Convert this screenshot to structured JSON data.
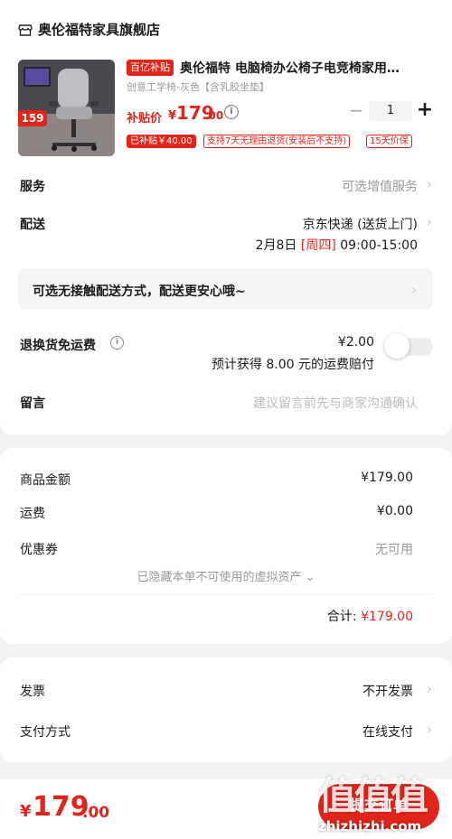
{
  "store": {
    "name": "奥伦福特家具旗舰店"
  },
  "product": {
    "promo_tag": "百亿补贴",
    "title": "奥伦福特 电脑椅办公椅子电竞椅家用…",
    "spec": "创意工学椅-灰色【含乳胶坐垫】",
    "subsidy_label": "补贴价",
    "price_symbol": "¥",
    "price_int": "179",
    "price_dec": ".00",
    "info_icon": "i",
    "quantity": "1",
    "qty_minus": "−",
    "qty_plus": "+",
    "image_badge": "159",
    "tags": [
      "已补贴￥40.00",
      "支持7天无理由退货(安装后不支持)",
      "15天价保"
    ]
  },
  "service": {
    "label": "服务",
    "value": "可选增值服务"
  },
  "delivery": {
    "label": "配送",
    "method": "京东快递 (送货上门)",
    "date": "2月8日",
    "weekday": "[周四]",
    "time": "09:00-15:00"
  },
  "contactless": {
    "text": "可选无接触配送方式，配送更安心哦~"
  },
  "return_shipping": {
    "label": "退换货免运费",
    "price": "¥2.00",
    "note": "预计获得 8.00 元的运费赔付",
    "enabled": false
  },
  "message": {
    "label": "留言",
    "placeholder": "建议留言前先与商家沟通确认"
  },
  "summary": {
    "goods_label": "商品金额",
    "goods_value": "¥179.00",
    "shipping_label": "运费",
    "shipping_value": "¥0.00",
    "coupon_label": "优惠券",
    "coupon_value": "无可用",
    "hidden_assets": "已隐藏本单不可使用的虚拟资产",
    "total_label": "合计:",
    "total_value": "¥179.00"
  },
  "invoice": {
    "label": "发票",
    "value": "不开发票"
  },
  "payment": {
    "label": "支付方式",
    "value": "在线支付"
  },
  "bottom": {
    "yen": "¥",
    "total_int": "179",
    "total_dec": ".00",
    "submit_label": "提交订单",
    "watermark_logo": "值值值",
    "watermark_url": "zhizhizhi.com"
  },
  "chevron": "›",
  "accent_color": "#e1251b"
}
